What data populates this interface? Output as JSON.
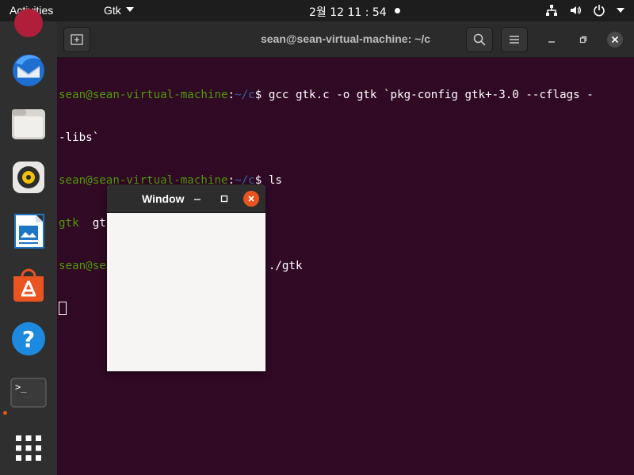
{
  "topbar": {
    "activities_label": "Activities",
    "app_menu_label": "Gtk",
    "clock": "2월 12  11 : 54",
    "icons": [
      "network-icon",
      "volume-icon",
      "power-icon",
      "chevron-down-icon"
    ]
  },
  "dock": {
    "apps": [
      {
        "name": "thunderbird-icon"
      },
      {
        "name": "files-icon"
      },
      {
        "name": "rhythmbox-icon"
      },
      {
        "name": "libreoffice-writer-icon"
      },
      {
        "name": "software-center-icon"
      },
      {
        "name": "help-icon"
      },
      {
        "name": "terminal-icon"
      },
      {
        "name": "show-apps-icon"
      }
    ],
    "colors": {
      "accent": "#e95420"
    }
  },
  "terminal": {
    "title": "sean@sean-virtual-machine: ~/c",
    "prompt_user": "sean@sean-virtual-machine",
    "prompt_sep": ":",
    "prompt_path": "~/c",
    "prompt_end": "$ ",
    "cmd1": "gcc gtk.c -o gtk `pkg-config gtk+-3.0 --cflags -",
    "cmd1_wrap": "-libs`",
    "cmd2": "ls",
    "ls_out_exec": "gtk",
    "ls_out_file": "  gtk.c",
    "cmd3": "./gtk",
    "colors": {
      "background": "#300a24",
      "user": "#4e9a06",
      "path": "#3465a4"
    }
  },
  "gtk_window": {
    "title": "Window",
    "minimize_label": "–",
    "maximize_label": "□"
  }
}
